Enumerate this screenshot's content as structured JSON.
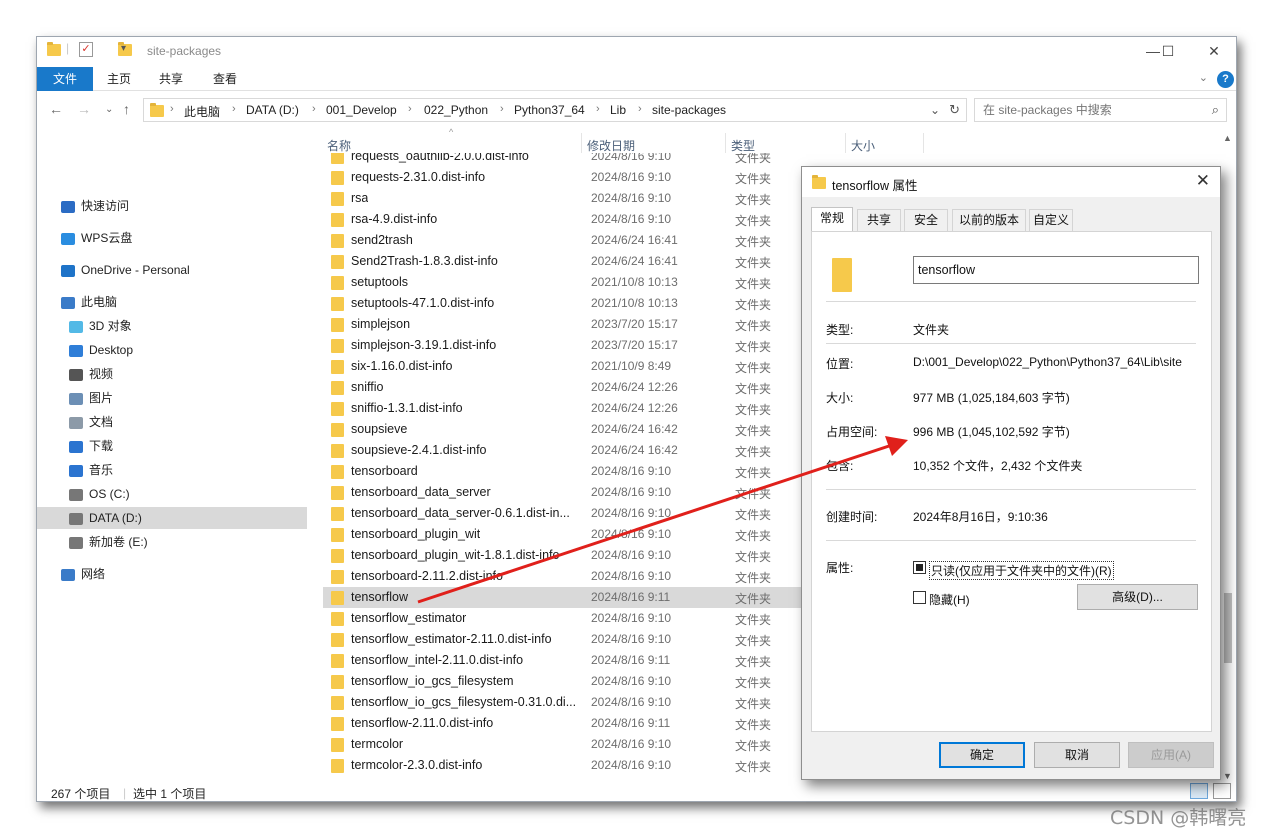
{
  "explorer": {
    "title": "site-packages",
    "ribbon_tabs": [
      "文件",
      "主页",
      "共享",
      "查看"
    ],
    "breadcrumb": [
      "此电脑",
      "DATA (D:)",
      "001_Develop",
      "022_Python",
      "Python37_64",
      "Lib",
      "site-packages"
    ],
    "search_placeholder": "在 site-packages 中搜索",
    "columns": {
      "name": "名称",
      "date": "修改日期",
      "type": "类型",
      "size": "大小"
    },
    "nav_items": [
      {
        "label": "快速访问",
        "icon": "star-icon"
      },
      {
        "label": "WPS云盘",
        "icon": "cloud-icon"
      },
      {
        "label": "OneDrive - Personal",
        "icon": "onedrive-icon"
      },
      {
        "label": "此电脑",
        "icon": "computer-icon"
      },
      {
        "label": "3D 对象",
        "icon": "cube-icon"
      },
      {
        "label": "Desktop",
        "icon": "desktop-icon"
      },
      {
        "label": "视频",
        "icon": "video-icon"
      },
      {
        "label": "图片",
        "icon": "picture-icon"
      },
      {
        "label": "文档",
        "icon": "document-icon"
      },
      {
        "label": "下载",
        "icon": "download-icon"
      },
      {
        "label": "音乐",
        "icon": "music-icon"
      },
      {
        "label": "OS (C:)",
        "icon": "drive-icon"
      },
      {
        "label": "DATA (D:)",
        "icon": "drive-icon"
      },
      {
        "label": "新加卷 (E:)",
        "icon": "drive-icon"
      },
      {
        "label": "网络",
        "icon": "network-icon"
      }
    ],
    "files": [
      {
        "name": "requests_oauthlib-2.0.0.dist-info",
        "date": "2024/8/16 9:10",
        "type": "文件夹"
      },
      {
        "name": "requests-2.31.0.dist-info",
        "date": "2024/8/16 9:10",
        "type": "文件夹"
      },
      {
        "name": "rsa",
        "date": "2024/8/16 9:10",
        "type": "文件夹"
      },
      {
        "name": "rsa-4.9.dist-info",
        "date": "2024/8/16 9:10",
        "type": "文件夹"
      },
      {
        "name": "send2trash",
        "date": "2024/6/24 16:41",
        "type": "文件夹"
      },
      {
        "name": "Send2Trash-1.8.3.dist-info",
        "date": "2024/6/24 16:41",
        "type": "文件夹"
      },
      {
        "name": "setuptools",
        "date": "2021/10/8 10:13",
        "type": "文件夹"
      },
      {
        "name": "setuptools-47.1.0.dist-info",
        "date": "2021/10/8 10:13",
        "type": "文件夹"
      },
      {
        "name": "simplejson",
        "date": "2023/7/20 15:17",
        "type": "文件夹"
      },
      {
        "name": "simplejson-3.19.1.dist-info",
        "date": "2023/7/20 15:17",
        "type": "文件夹"
      },
      {
        "name": "six-1.16.0.dist-info",
        "date": "2021/10/9 8:49",
        "type": "文件夹"
      },
      {
        "name": "sniffio",
        "date": "2024/6/24 12:26",
        "type": "文件夹"
      },
      {
        "name": "sniffio-1.3.1.dist-info",
        "date": "2024/6/24 12:26",
        "type": "文件夹"
      },
      {
        "name": "soupsieve",
        "date": "2024/6/24 16:42",
        "type": "文件夹"
      },
      {
        "name": "soupsieve-2.4.1.dist-info",
        "date": "2024/6/24 16:42",
        "type": "文件夹"
      },
      {
        "name": "tensorboard",
        "date": "2024/8/16 9:10",
        "type": "文件夹"
      },
      {
        "name": "tensorboard_data_server",
        "date": "2024/8/16 9:10",
        "type": "文件夹"
      },
      {
        "name": "tensorboard_data_server-0.6.1.dist-in...",
        "date": "2024/8/16 9:10",
        "type": "文件夹"
      },
      {
        "name": "tensorboard_plugin_wit",
        "date": "2024/8/16 9:10",
        "type": "文件夹"
      },
      {
        "name": "tensorboard_plugin_wit-1.8.1.dist-info",
        "date": "2024/8/16 9:10",
        "type": "文件夹"
      },
      {
        "name": "tensorboard-2.11.2.dist-info",
        "date": "2024/8/16 9:10",
        "type": "文件夹"
      },
      {
        "name": "tensorflow",
        "date": "2024/8/16 9:11",
        "type": "文件夹",
        "selected": true
      },
      {
        "name": "tensorflow_estimator",
        "date": "2024/8/16 9:10",
        "type": "文件夹"
      },
      {
        "name": "tensorflow_estimator-2.11.0.dist-info",
        "date": "2024/8/16 9:10",
        "type": "文件夹"
      },
      {
        "name": "tensorflow_intel-2.11.0.dist-info",
        "date": "2024/8/16 9:11",
        "type": "文件夹"
      },
      {
        "name": "tensorflow_io_gcs_filesystem",
        "date": "2024/8/16 9:10",
        "type": "文件夹"
      },
      {
        "name": "tensorflow_io_gcs_filesystem-0.31.0.di...",
        "date": "2024/8/16 9:10",
        "type": "文件夹"
      },
      {
        "name": "tensorflow-2.11.0.dist-info",
        "date": "2024/8/16 9:11",
        "type": "文件夹"
      },
      {
        "name": "termcolor",
        "date": "2024/8/16 9:10",
        "type": "文件夹"
      },
      {
        "name": "termcolor-2.3.0.dist-info",
        "date": "2024/8/16 9:10",
        "type": "文件夹"
      }
    ],
    "status": {
      "count": "267 个项目",
      "selected": "选中 1 个项目"
    }
  },
  "dialog": {
    "title": "tensorflow 属性",
    "tabs": [
      "常规",
      "共享",
      "安全",
      "以前的版本",
      "自定义"
    ],
    "name_value": "tensorflow",
    "props": {
      "type_label": "类型:",
      "type_value": "文件夹",
      "location_label": "位置:",
      "location_value": "D:\\001_Develop\\022_Python\\Python37_64\\Lib\\site",
      "size_label": "大小:",
      "size_value": "977 MB (1,025,184,603 字节)",
      "disk_label": "占用空间:",
      "disk_value": "996 MB (1,045,102,592 字节)",
      "contains_label": "包含:",
      "contains_value": "10,352 个文件，2,432 个文件夹",
      "created_label": "创建时间:",
      "created_value": "2024年8月16日，9:10:36",
      "attr_label": "属性:",
      "readonly_label": "只读(仅应用于文件夹中的文件)(R)",
      "hidden_label": "隐藏(H)",
      "advanced_label": "高级(D)..."
    },
    "buttons": {
      "ok": "确定",
      "cancel": "取消",
      "apply": "应用(A)"
    }
  },
  "watermark": "CSDN @韩曙亮",
  "colors": {
    "accent": "#1979ca",
    "arrow": "#e0201b",
    "folder": "#f6c94b"
  }
}
